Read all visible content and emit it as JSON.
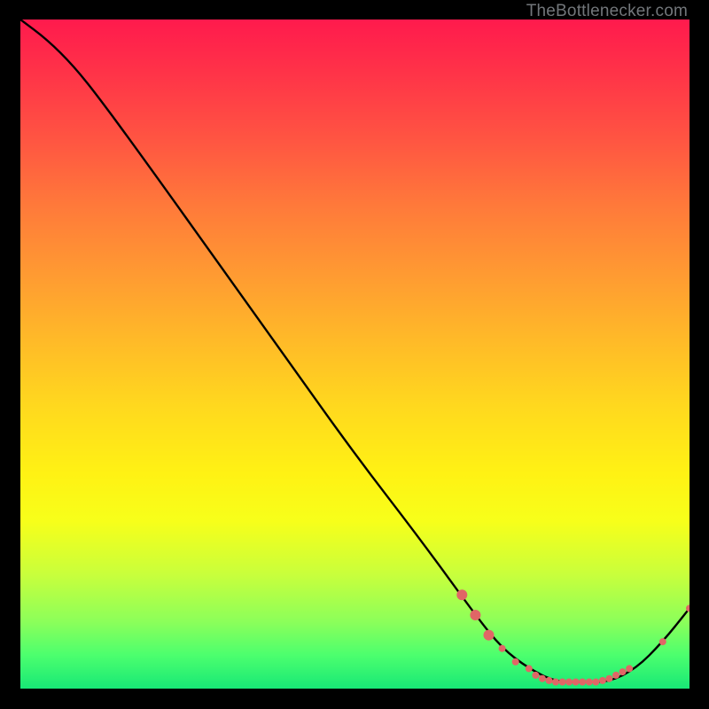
{
  "watermark": "TheBottlenecker.com",
  "chart_data": {
    "type": "line",
    "title": "",
    "xlabel": "",
    "ylabel": "",
    "xlim": [
      0,
      100
    ],
    "ylim": [
      0,
      100
    ],
    "series": [
      {
        "name": "curve",
        "x": [
          0,
          4,
          8,
          12,
          20,
          30,
          40,
          50,
          60,
          68,
          72,
          76,
          80,
          84,
          88,
          92,
          96,
          100
        ],
        "y": [
          100,
          97,
          93,
          88,
          77,
          63,
          49,
          35,
          22,
          11,
          6,
          3,
          1,
          1,
          1,
          3,
          7,
          12
        ]
      }
    ],
    "markers": {
      "name": "highlight-points",
      "color": "#e06666",
      "radius_major": 6,
      "radius_minor": 4,
      "points": [
        {
          "x": 66,
          "y": 14,
          "r": "major"
        },
        {
          "x": 68,
          "y": 11,
          "r": "major"
        },
        {
          "x": 70,
          "y": 8,
          "r": "major"
        },
        {
          "x": 72,
          "y": 6,
          "r": "minor"
        },
        {
          "x": 74,
          "y": 4,
          "r": "minor"
        },
        {
          "x": 76,
          "y": 3,
          "r": "minor"
        },
        {
          "x": 77,
          "y": 2,
          "r": "minor"
        },
        {
          "x": 78,
          "y": 1.5,
          "r": "minor"
        },
        {
          "x": 79,
          "y": 1.2,
          "r": "minor"
        },
        {
          "x": 80,
          "y": 1,
          "r": "minor"
        },
        {
          "x": 81,
          "y": 1,
          "r": "minor"
        },
        {
          "x": 82,
          "y": 1,
          "r": "minor"
        },
        {
          "x": 83,
          "y": 1,
          "r": "minor"
        },
        {
          "x": 84,
          "y": 1,
          "r": "minor"
        },
        {
          "x": 85,
          "y": 1,
          "r": "minor"
        },
        {
          "x": 86,
          "y": 1,
          "r": "minor"
        },
        {
          "x": 87,
          "y": 1.2,
          "r": "minor"
        },
        {
          "x": 88,
          "y": 1.5,
          "r": "minor"
        },
        {
          "x": 89,
          "y": 2,
          "r": "minor"
        },
        {
          "x": 90,
          "y": 2.5,
          "r": "minor"
        },
        {
          "x": 91,
          "y": 3,
          "r": "minor"
        },
        {
          "x": 96,
          "y": 7,
          "r": "minor"
        },
        {
          "x": 100,
          "y": 12,
          "r": "minor"
        }
      ]
    }
  }
}
